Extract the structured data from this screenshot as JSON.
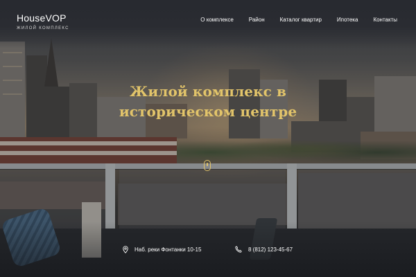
{
  "brand": {
    "name": "HouseVOP",
    "tagline": "Жилой комплекс"
  },
  "nav": {
    "items": [
      {
        "label": "О комплексе"
      },
      {
        "label": "Район"
      },
      {
        "label": "Каталог квартир"
      },
      {
        "label": "Ипотека"
      },
      {
        "label": "Контакты"
      }
    ]
  },
  "hero": {
    "title_line1": "Жилой комплекс в",
    "title_line2": "историческом центре"
  },
  "contacts": {
    "address": "Наб. реки Фонтанки 10-15",
    "phone": "8 (812) 123-45-67"
  },
  "colors": {
    "accent": "#e2c46a",
    "header_bg": "#282a30",
    "text": "#ffffff"
  },
  "icons": {
    "address": "location-pin-icon",
    "phone": "phone-icon",
    "scroll": "mouse-scroll-icon"
  }
}
